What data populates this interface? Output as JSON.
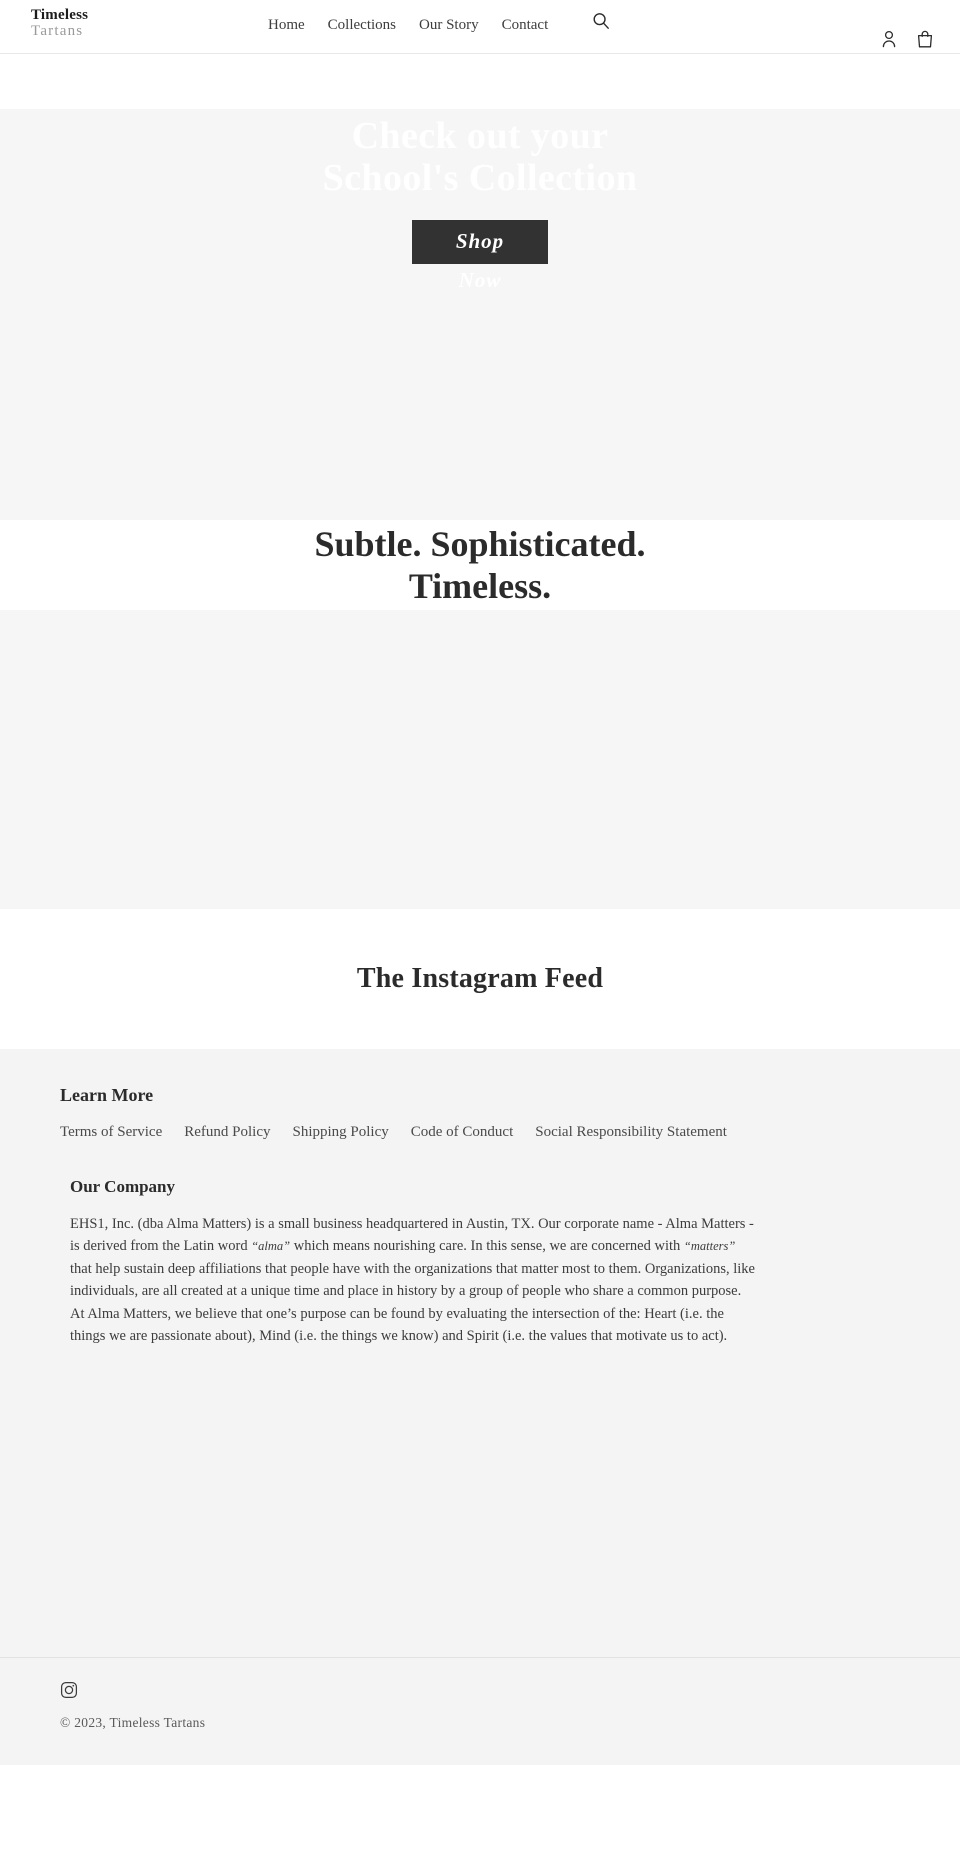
{
  "header": {
    "logo": {
      "line1": "Timeless",
      "line2": "Tartans"
    },
    "nav": [
      {
        "label": "Home"
      },
      {
        "label": "Collections"
      },
      {
        "label": "Our Story"
      },
      {
        "label": "Contact"
      }
    ],
    "icons": {
      "search": "search-icon",
      "account": "account-icon",
      "cart": "cart-icon"
    }
  },
  "hero": {
    "title_line1": "Check out your",
    "title_line2": "School's Collection",
    "cta_label": "Shop",
    "cta_sub": "Now"
  },
  "tagline": {
    "line1": "Subtle. Sophisticated.",
    "line2": "Timeless."
  },
  "instagram": {
    "title": "The Instagram Feed"
  },
  "footer": {
    "learn_more_heading": "Learn More",
    "links": [
      {
        "label": "Terms of Service"
      },
      {
        "label": "Refund Policy"
      },
      {
        "label": "Shipping Policy"
      },
      {
        "label": "Code of Conduct"
      },
      {
        "label": "Social Responsibility Statement"
      }
    ],
    "company_heading": "Our Company",
    "company_text_part1": "EHS1, Inc. (dba Alma Matters) is a small business headquartered in Austin, TX. Our corporate name - Alma Matters - is derived from the Latin word ",
    "company_quote1": "“alma”",
    "company_text_part2": " which means nourishing care. In this sense, we are concerned with ",
    "company_quote2": "“matters”",
    "company_text_part3": " that help sustain deep affiliations that people have with the organizations that matter most to them. Organizations, like individuals, are all created at a unique time and place in history by a group of people who share a common purpose. At Alma Matters, we believe that one’s purpose can be found by evaluating the intersection of the: Heart (i.e. the things we are passionate about), Mind (i.e. the things we know) and Spirit (i.e. the values that motivate us to act).",
    "social": [
      {
        "name": "instagram-icon"
      }
    ],
    "copyright": "© 2023, Timeless Tartans"
  },
  "colors": {
    "accent_dark": "#323232",
    "page_bg": "#ffffff",
    "section_bg": "#f6f6f6",
    "footer_bg": "#f4f4f4",
    "text": "#333333"
  }
}
